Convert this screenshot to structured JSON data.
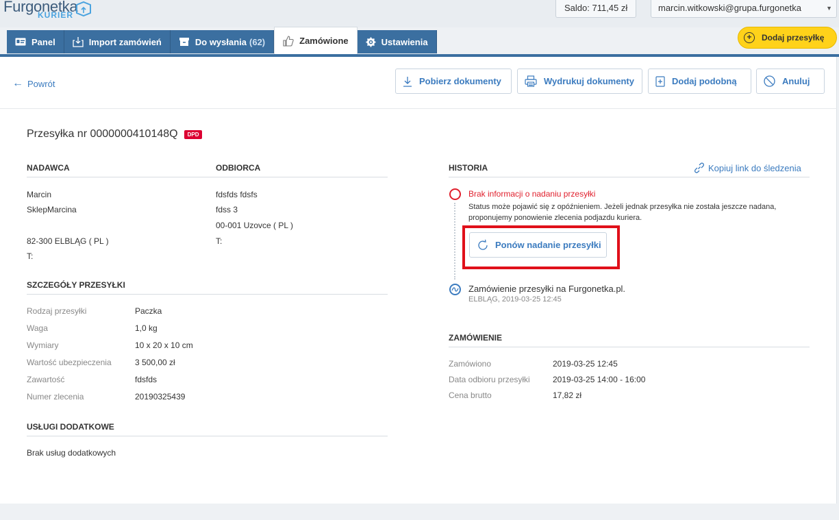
{
  "brand": {
    "name": "Furgonetka",
    "sub": "KURIER"
  },
  "topbar": {
    "saldo": "Saldo: 711,45 zł",
    "user": "marcin.witkowski@grupa.furgonetka"
  },
  "tabs": [
    {
      "label": "Panel",
      "icon": "id-card-icon"
    },
    {
      "label": "Import zamówień",
      "icon": "import-icon"
    },
    {
      "label": "Do wysłania",
      "count": "(62)",
      "icon": "box-icon"
    },
    {
      "label": "Zamówione",
      "icon": "thumbs-up-icon"
    },
    {
      "label": "Ustawienia",
      "icon": "gear-icon"
    }
  ],
  "add_button": "Dodaj przesyłkę",
  "actions": {
    "back": "Powrót",
    "download": "Pobierz dokumenty",
    "print": "Wydrukuj dokumenty",
    "add_similar": "Dodaj podobną",
    "cancel": "Anuluj"
  },
  "shipment": {
    "title": "Przesyłka nr 0000000410148Q",
    "carrier": "DPD"
  },
  "sender": {
    "heading": "NADAWCA",
    "name": "Marcin",
    "company": "SklepMarcina",
    "city": "82-300 ELBLĄG ( PL )",
    "phone": "T:"
  },
  "recipient": {
    "heading": "ODBIORCA",
    "name": "fdsfds fdsfs",
    "street": "fdss 3",
    "city": "00-001 Uzovce ( PL )",
    "phone": "T:"
  },
  "details": {
    "heading": "SZCZEGÓŁY PRZESYŁKI",
    "rows": [
      {
        "k": "Rodzaj przesyłki",
        "v": "Paczka"
      },
      {
        "k": "Waga",
        "v": "1,0 kg"
      },
      {
        "k": "Wymiary",
        "v": "10 x 20 x 10 cm"
      },
      {
        "k": "Wartość ubezpieczenia",
        "v": "3 500,00 zł"
      },
      {
        "k": "Zawartość",
        "v": "fdsfds"
      },
      {
        "k": "Numer zlecenia",
        "v": "20190325439"
      }
    ]
  },
  "extras": {
    "heading": "USŁUGI DODATKOWE",
    "text": "Brak usług dodatkowych"
  },
  "history": {
    "heading": "HISTORIA",
    "copy_link": "Kopiuj link do śledzenia",
    "status_title": "Brak informacji o nadaniu przesyłki",
    "status_note": "Status może pojawić się z opóźnieniem. Jeżeli jednak przesyłka nie została jeszcze nadana, proponujemy ponowienie zlecenia podjazdu kuriera.",
    "retry_button": "Ponów nadanie przesyłki",
    "event_title": "Zamówienie przesyłki na Furgonetka.pl.",
    "event_sub": "ELBLĄG, 2019-03-25 12:45"
  },
  "order": {
    "heading": "ZAMÓWIENIE",
    "rows": [
      {
        "k": "Zamówiono",
        "v": "2019-03-25 12:45"
      },
      {
        "k": "Data odbioru przesyłki",
        "v": "2019-03-25 14:00 - 16:00"
      },
      {
        "k": "Cena brutto",
        "v": "17,82 zł"
      }
    ]
  }
}
